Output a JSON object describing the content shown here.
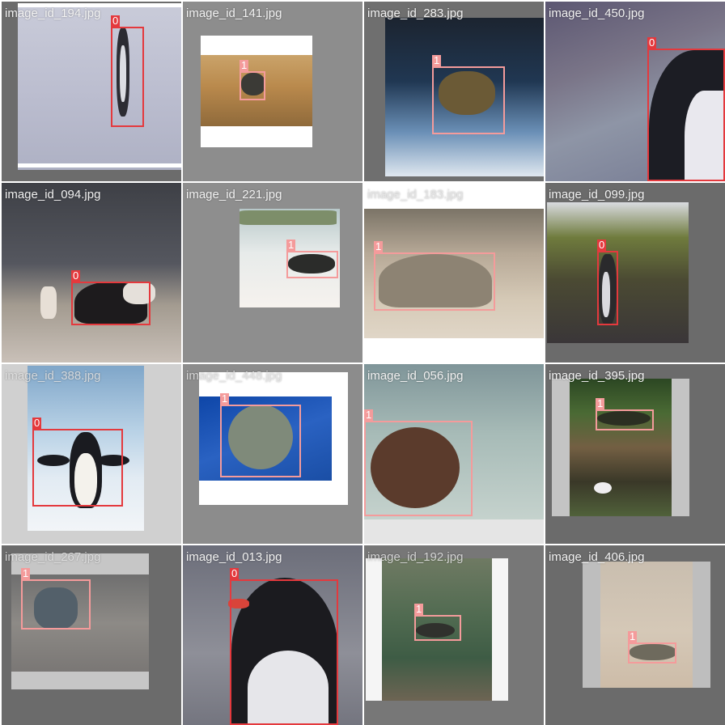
{
  "grid": {
    "columns": 4,
    "rows": 4
  },
  "colors": {
    "class_0_box": "#e4393d",
    "class_1_box": "#f49b9b",
    "tile_pad_dark": "#6a6a6a",
    "tile_pad_mid": "#8c8c8c",
    "tile_pad_light": "#c8c8c8",
    "title_text": "#f2f2f2"
  },
  "tiles": [
    {
      "id": "image_id_194.jpg",
      "subject": "penguin",
      "boxes": [
        {
          "label": "0"
        }
      ]
    },
    {
      "id": "image_id_141.jpg",
      "subject": "turtle",
      "boxes": [
        {
          "label": "1"
        }
      ]
    },
    {
      "id": "image_id_283.jpg",
      "subject": "turtle",
      "boxes": [
        {
          "label": "1"
        }
      ]
    },
    {
      "id": "image_id_450.jpg",
      "subject": "penguin",
      "boxes": [
        {
          "label": "0"
        }
      ]
    },
    {
      "id": "image_id_094.jpg",
      "subject": "penguin",
      "boxes": [
        {
          "label": "0"
        }
      ]
    },
    {
      "id": "image_id_221.jpg",
      "subject": "turtle",
      "boxes": [
        {
          "label": "1"
        }
      ]
    },
    {
      "id": "image_id_183.jpg",
      "subject": "turtle",
      "boxes": [
        {
          "label": "1"
        }
      ]
    },
    {
      "id": "image_id_099.jpg",
      "subject": "penguin",
      "boxes": [
        {
          "label": "0"
        }
      ]
    },
    {
      "id": "image_id_388.jpg",
      "subject": "penguin",
      "boxes": [
        {
          "label": "0"
        }
      ]
    },
    {
      "id": "image_id_448.jpg",
      "subject": "turtle",
      "boxes": [
        {
          "label": "1"
        }
      ]
    },
    {
      "id": "image_id_056.jpg",
      "subject": "turtle",
      "boxes": [
        {
          "label": "1"
        }
      ]
    },
    {
      "id": "image_id_395.jpg",
      "subject": "turtle",
      "boxes": [
        {
          "label": "1"
        }
      ]
    },
    {
      "id": "image_id_267.jpg",
      "subject": "turtle",
      "boxes": [
        {
          "label": "1"
        }
      ]
    },
    {
      "id": "image_id_013.jpg",
      "subject": "penguin",
      "boxes": [
        {
          "label": "0"
        }
      ]
    },
    {
      "id": "image_id_192.jpg",
      "subject": "turtle",
      "boxes": [
        {
          "label": "1"
        }
      ]
    },
    {
      "id": "image_id_406.jpg",
      "subject": "turtle",
      "boxes": [
        {
          "label": "1"
        }
      ]
    }
  ]
}
